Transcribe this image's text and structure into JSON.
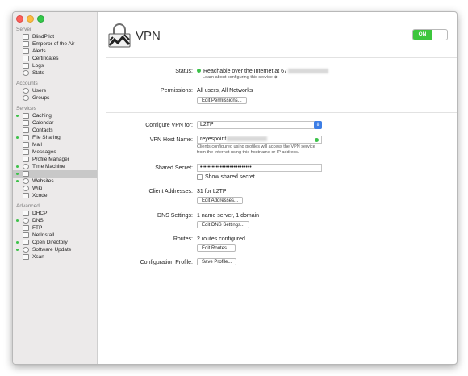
{
  "sidebar": {
    "sections": [
      {
        "header": "Server",
        "items": [
          {
            "label": "BlindPilot",
            "icon": "server-icon",
            "active": false
          },
          {
            "label": "Emperor of the Air",
            "icon": "server-icon",
            "active": false
          },
          {
            "label": "Alerts",
            "icon": "alerts-icon",
            "active": false
          },
          {
            "label": "Certificates",
            "icon": "certificate-icon",
            "active": false
          },
          {
            "label": "Logs",
            "icon": "logs-icon",
            "active": false
          },
          {
            "label": "Stats",
            "icon": "stats-icon",
            "active": false
          }
        ]
      },
      {
        "header": "Accounts",
        "items": [
          {
            "label": "Users",
            "icon": "users-icon",
            "active": false
          },
          {
            "label": "Groups",
            "icon": "groups-icon",
            "active": false
          }
        ]
      },
      {
        "header": "Services",
        "items": [
          {
            "label": "Caching",
            "icon": "caching-icon",
            "active": true
          },
          {
            "label": "Calendar",
            "icon": "calendar-icon",
            "active": false
          },
          {
            "label": "Contacts",
            "icon": "contacts-icon",
            "active": false
          },
          {
            "label": "File Sharing",
            "icon": "file-sharing-icon",
            "active": true
          },
          {
            "label": "Mail",
            "icon": "mail-icon",
            "active": false
          },
          {
            "label": "Messages",
            "icon": "messages-icon",
            "active": false
          },
          {
            "label": "Profile Manager",
            "icon": "profile-manager-icon",
            "active": false
          },
          {
            "label": "Time Machine",
            "icon": "time-machine-icon",
            "active": true
          },
          {
            "label": "",
            "icon": "vpn-icon",
            "active": true,
            "selected": true
          },
          {
            "label": "Websites",
            "icon": "websites-icon",
            "active": true
          },
          {
            "label": "Wiki",
            "icon": "wiki-icon",
            "active": false
          },
          {
            "label": "Xcode",
            "icon": "xcode-icon",
            "active": false
          }
        ]
      },
      {
        "header": "Advanced",
        "items": [
          {
            "label": "DHCP",
            "icon": "dhcp-icon",
            "active": false
          },
          {
            "label": "DNS",
            "icon": "dns-icon",
            "active": true
          },
          {
            "label": "FTP",
            "icon": "ftp-icon",
            "active": false
          },
          {
            "label": "NetInstall",
            "icon": "netinstall-icon",
            "active": false
          },
          {
            "label": "Open Directory",
            "icon": "open-directory-icon",
            "active": true
          },
          {
            "label": "Software Update",
            "icon": "software-update-icon",
            "active": true
          },
          {
            "label": "Xsan",
            "icon": "xsan-icon",
            "active": false
          }
        ]
      }
    ]
  },
  "header": {
    "title": "VPN",
    "toggle_label": "ON"
  },
  "status": {
    "label": "Status:",
    "value": "Reachable over the Internet at 67",
    "note": "Learn about configuring this service"
  },
  "permissions": {
    "label": "Permissions:",
    "value": "All users, All Networks",
    "button": "Edit Permissions..."
  },
  "configure": {
    "label": "Configure VPN for:",
    "value": "L2TP"
  },
  "host": {
    "label": "VPN Host Name:",
    "value": "reyespoint",
    "help_line1": "Clients configured using profiles will access the VPN service",
    "help_line2": "from the Internet using this hostname or IP address."
  },
  "secret": {
    "label": "Shared Secret:",
    "value": "••••••••••••••••••••••••••",
    "checkbox_label": "Show shared secret"
  },
  "client": {
    "label": "Client Addresses:",
    "value": "31 for L2TP",
    "button": "Edit Addresses..."
  },
  "dns": {
    "label": "DNS Settings:",
    "value": "1 name server, 1 domain",
    "button": "Edit DNS Settings..."
  },
  "routes": {
    "label": "Routes:",
    "value": "2 routes configured",
    "button": "Edit Routes..."
  },
  "profile": {
    "label": "Configuration Profile:",
    "button": "Save Profile..."
  },
  "colors": {
    "accent_green": "#3cc63c",
    "select_blue": "#3d7ee6",
    "sidebar_bg": "#eceaea"
  }
}
